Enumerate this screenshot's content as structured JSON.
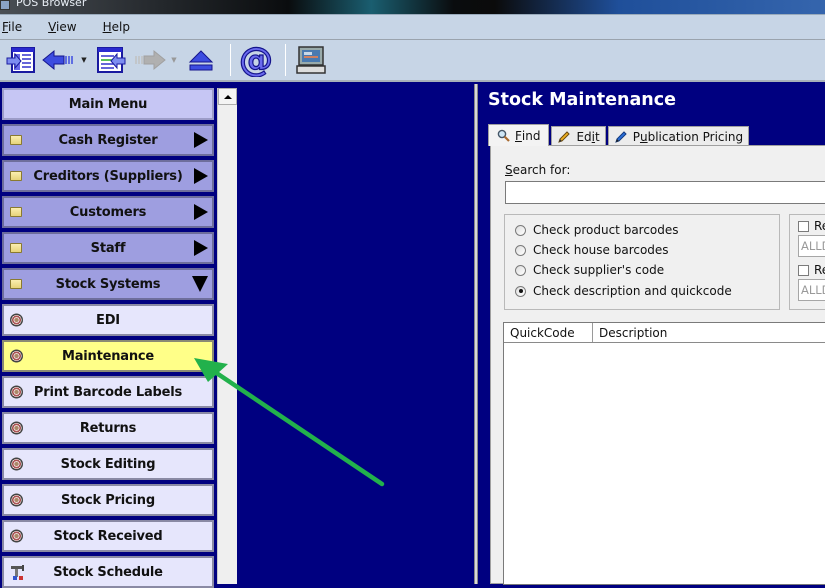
{
  "window": {
    "title": "POS Browser"
  },
  "menubar": {
    "items": [
      {
        "label": "File",
        "mnemonic": "F",
        "rest": "ile"
      },
      {
        "label": "View",
        "mnemonic": "V",
        "rest": "iew"
      },
      {
        "label": "Help",
        "mnemonic": "H",
        "rest": "elp"
      }
    ]
  },
  "toolbar": {
    "buttons": [
      {
        "name": "open-panel-icon",
        "enabled": true
      },
      {
        "name": "back-arrow-icon",
        "enabled": true,
        "dropdown": true
      },
      {
        "name": "import-list-icon",
        "enabled": true
      },
      {
        "name": "forward-arrow-icon",
        "enabled": false,
        "dropdown": true
      },
      {
        "name": "eject-icon",
        "enabled": true
      },
      {
        "name": "email-at-icon",
        "enabled": true
      },
      {
        "name": "computer-icon",
        "enabled": true
      }
    ]
  },
  "left_menu": {
    "header": "Main Menu",
    "items": [
      {
        "label": "Cash Register",
        "type": "group",
        "icon": "folder-icon",
        "expanded": false
      },
      {
        "label": "Creditors (Suppliers)",
        "type": "group",
        "icon": "folder-icon",
        "expanded": false
      },
      {
        "label": "Customers",
        "type": "group",
        "icon": "folder-icon",
        "expanded": false
      },
      {
        "label": "Staff",
        "type": "group",
        "icon": "folder-icon",
        "expanded": false
      },
      {
        "label": "Stock Systems",
        "type": "group",
        "icon": "folder-icon",
        "expanded": true
      },
      {
        "label": "EDI",
        "type": "sub",
        "icon": "target-icon"
      },
      {
        "label": "Maintenance",
        "type": "sub",
        "icon": "target-icon",
        "active": true
      },
      {
        "label": "Print Barcode Labels",
        "type": "sub",
        "icon": "target-icon"
      },
      {
        "label": "Returns",
        "type": "sub",
        "icon": "target-icon"
      },
      {
        "label": "Stock Editing",
        "type": "sub",
        "icon": "target-icon"
      },
      {
        "label": "Stock Pricing",
        "type": "sub",
        "icon": "target-icon"
      },
      {
        "label": "Stock Received",
        "type": "sub",
        "icon": "target-icon"
      },
      {
        "label": "Stock Schedule",
        "type": "sub",
        "icon": "tools-icon"
      }
    ]
  },
  "stock_maintenance": {
    "title": "Stock Maintenance",
    "tabs": [
      {
        "label": "Find",
        "mnemonic": "F",
        "rest": "ind",
        "icon": "magnifier-icon",
        "active": true
      },
      {
        "label": "Edit",
        "pre": "Ed",
        "mnemonic": "i",
        "rest": "t",
        "icon": "pencil-icon",
        "active": false
      },
      {
        "label": "Publication Pricing",
        "pre": "P",
        "mnemonic": "u",
        "rest": "blication Pricing",
        "icon": "pen-icon",
        "active": false
      }
    ],
    "search": {
      "label": "Search for:",
      "label_mnemonic": "S",
      "label_rest": "earch for:",
      "value": "",
      "placeholder": ""
    },
    "search_options": [
      {
        "label": "Check product barcodes",
        "checked": false
      },
      {
        "label": "Check house barcodes",
        "checked": false
      },
      {
        "label": "Check supplier's code",
        "checked": false
      },
      {
        "label": "Check description and quickcode",
        "checked": true
      }
    ],
    "restrict_options": [
      {
        "label": "Re",
        "checked": false,
        "value": "ALLD"
      },
      {
        "label": "Re",
        "checked": false,
        "value": "ALLD"
      }
    ],
    "results_grid": {
      "columns": [
        "QuickCode",
        "Description"
      ],
      "rows": []
    }
  },
  "colors": {
    "background": "#000080",
    "active_item": "#ffff88",
    "group_item": "#9e9ee0",
    "sub_item": "#e6e6fc",
    "annotation_arrow": "#22b14c"
  }
}
